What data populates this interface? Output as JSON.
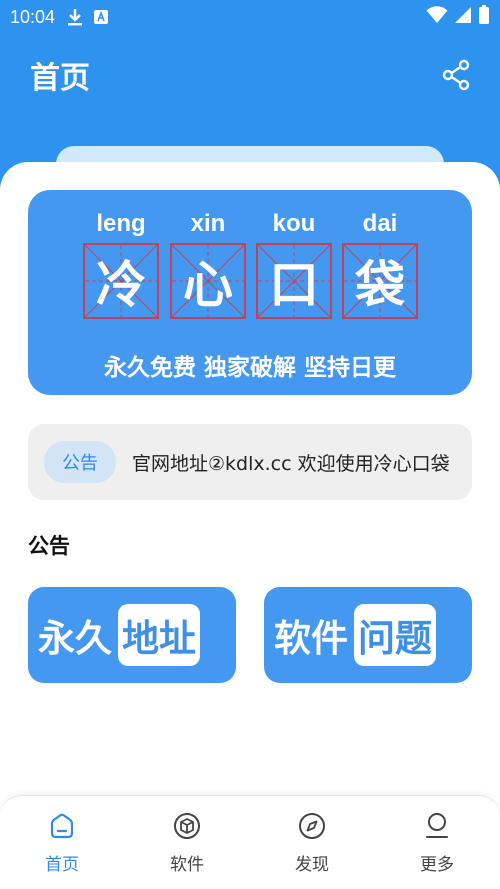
{
  "status_bar": {
    "time": "10:04"
  },
  "app_bar": {
    "title": "首页"
  },
  "banner": {
    "pinyin": [
      "leng",
      "xin",
      "kou",
      "dai"
    ],
    "characters": [
      "冷",
      "心",
      "口",
      "袋"
    ],
    "slogan": "永久免费 独家破解 坚持日更"
  },
  "notice": {
    "tag": "公告",
    "text": "官网地址②kdlx.cc   欢迎使用冷心口袋"
  },
  "section": {
    "title": "公告"
  },
  "tiles": [
    {
      "part1": "永久",
      "part2": "地址"
    },
    {
      "part1": "软件",
      "part2": "问题"
    }
  ],
  "bottom_nav": [
    {
      "label": "首页",
      "icon": "home-icon",
      "active": true
    },
    {
      "label": "软件",
      "icon": "box-icon",
      "active": false
    },
    {
      "label": "发现",
      "icon": "compass-icon",
      "active": false
    },
    {
      "label": "更多",
      "icon": "person-icon",
      "active": false
    }
  ],
  "colors": {
    "primary": "#2e93ee",
    "banner": "#4498ef",
    "grid_line": "#c0435a",
    "notice_bg": "#efefef",
    "active": "#2e8be8"
  }
}
